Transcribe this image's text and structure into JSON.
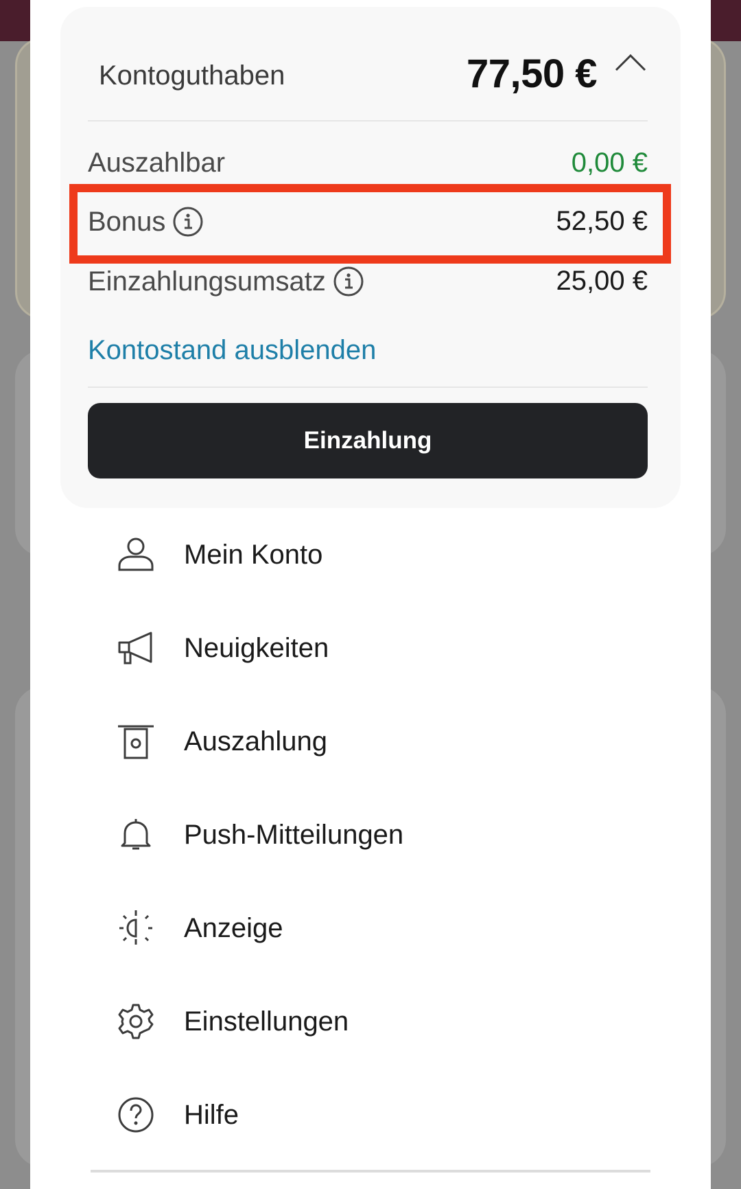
{
  "balance": {
    "title": "Kontoguthaben",
    "total": "77,50 €",
    "rows": [
      {
        "label": "Auszahlbar",
        "value": "0,00 €"
      },
      {
        "label": "Bonus",
        "value": "52,50 €"
      },
      {
        "label": "Einzahlungsumsatz",
        "value": "25,00 €"
      }
    ],
    "hide_link": "Kontostand ausblenden",
    "deposit_button": "Einzahlung"
  },
  "menu": {
    "items": [
      {
        "label": "Mein Konto",
        "icon": "user-icon"
      },
      {
        "label": "Neuigkeiten",
        "icon": "megaphone-icon"
      },
      {
        "label": "Auszahlung",
        "icon": "withdraw-icon"
      },
      {
        "label": "Push-Mitteilungen",
        "icon": "bell-icon"
      },
      {
        "label": "Anzeige",
        "icon": "display-brightness-icon"
      },
      {
        "label": "Einstellungen",
        "icon": "gear-icon"
      },
      {
        "label": "Hilfe",
        "icon": "help-icon"
      }
    ]
  },
  "colors": {
    "positive_value": "#1f8a3a",
    "link": "#1e7fa8",
    "primary_button": "#222326",
    "highlight_box": "#ee3a1b"
  }
}
